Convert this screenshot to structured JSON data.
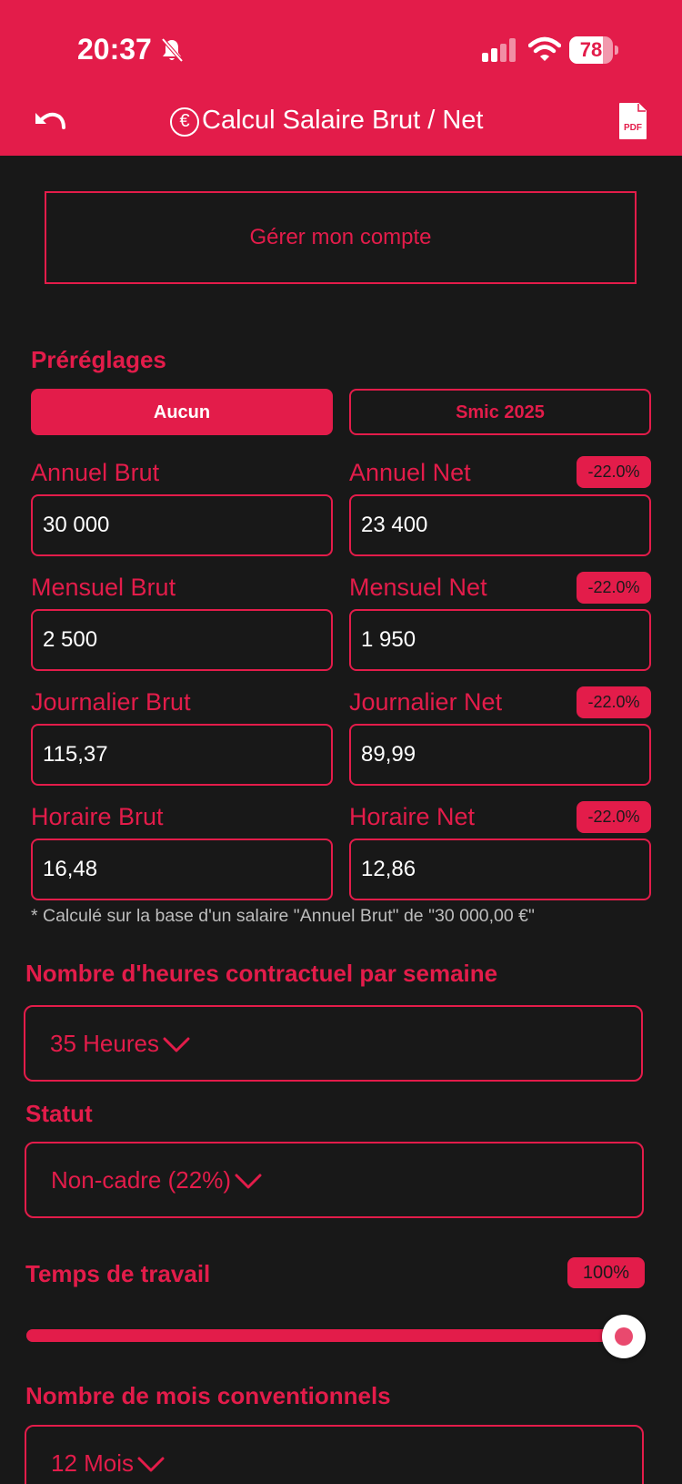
{
  "colors": {
    "accent": "#e31c4a",
    "background": "#181818",
    "text_light": "#ffffff",
    "footnote": "#bdbdbd"
  },
  "status_bar": {
    "time": "20:37",
    "battery": "78",
    "battery_level": 0.78,
    "icons": [
      "bell-slash-icon",
      "signal-icon",
      "wifi-icon",
      "battery-icon"
    ]
  },
  "header": {
    "title": "Calcul Salaire Brut / Net",
    "icons": [
      "undo-icon",
      "euro-icon",
      "pdf-icon"
    ],
    "pdf_label": "PDF"
  },
  "account_button": "Gérer mon compte",
  "presets": {
    "title": "Préréglages",
    "options": [
      "Aucun",
      "Smic 2025"
    ],
    "selected": "Aucun"
  },
  "fields": {
    "annuel_brut": {
      "label": "Annuel Brut",
      "value": "30 000"
    },
    "annuel_net": {
      "label": "Annuel Net",
      "value": "23 400",
      "badge": "-22.0%"
    },
    "mensuel_brut": {
      "label": "Mensuel Brut",
      "value": "2 500"
    },
    "mensuel_net": {
      "label": "Mensuel Net",
      "value": "1 950",
      "badge": "-22.0%"
    },
    "journalier_brut": {
      "label": "Journalier Brut",
      "value": "115,37"
    },
    "journalier_net": {
      "label": "Journalier Net",
      "value": "89,99",
      "badge": "-22.0%"
    },
    "horaire_brut": {
      "label": "Horaire Brut",
      "value": "16,48"
    },
    "horaire_net": {
      "label": "Horaire Net",
      "value": "12,86",
      "badge": "-22.0%"
    }
  },
  "footnote": "* Calculé sur la base d'un salaire \"Annuel Brut\" de \"30 000,00 €\"",
  "heures": {
    "title": "Nombre d'heures contractuel par semaine",
    "value": "35 Heures"
  },
  "statut": {
    "title": "Statut",
    "value": "Non-cadre (22%)"
  },
  "temps_travail": {
    "title": "Temps de travail",
    "badge": "100%",
    "level": 1.0
  },
  "mois": {
    "title": "Nombre de mois conventionnels",
    "value": "12 Mois"
  }
}
